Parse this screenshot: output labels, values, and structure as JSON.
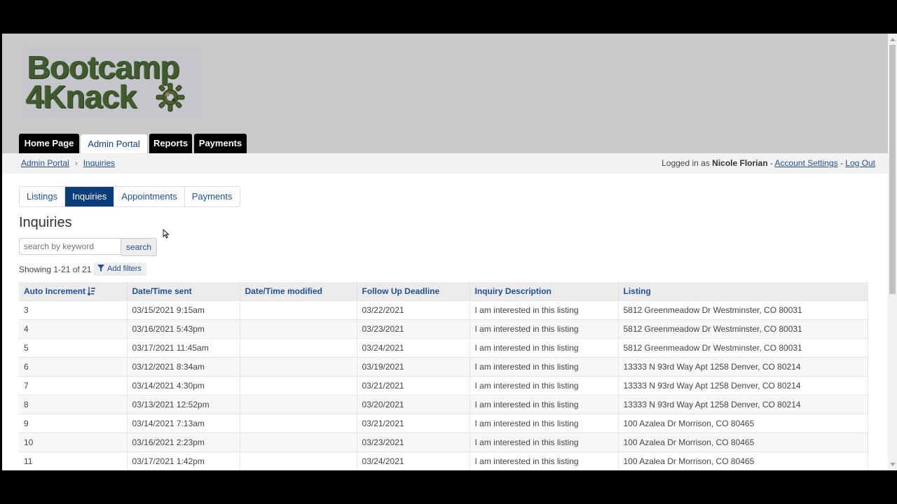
{
  "header": {
    "logo_line1": "Bootcamp",
    "logo_line2": "4Knack",
    "nav": [
      {
        "label": "Home Page"
      },
      {
        "label": "Admin Portal"
      },
      {
        "label": "Reports"
      },
      {
        "label": "Payments"
      }
    ],
    "colors": {
      "header_bg": "#c9c9c9",
      "nav_dark": "#000000",
      "accent": "#0b3d7a",
      "link": "#1f4e9c"
    }
  },
  "breadcrumb": {
    "items": [
      "Admin Portal",
      "Inquiries"
    ]
  },
  "account": {
    "prefix": "Logged in as",
    "user": "Nicole Florian",
    "dash1": "-",
    "settings": "Account Settings",
    "dash2": "-",
    "logout": "Log Out"
  },
  "subtabs": [
    "Listings",
    "Inquiries",
    "Appointments",
    "Payments"
  ],
  "page": {
    "title": "Inquiries"
  },
  "search": {
    "placeholder": "search by keyword",
    "button": "search"
  },
  "records": {
    "showing": "Showing 1-21 of 21",
    "add_filters": "Add filters"
  },
  "table": {
    "columns": [
      "Auto Increment",
      "Date/Time sent",
      "Date/Time modified",
      "Follow Up Deadline",
      "Inquiry Description",
      "Listing"
    ],
    "rows": [
      [
        "3",
        "03/15/2021 9:15am",
        "",
        "03/22/2021",
        "I am interested in this listing",
        "5812 Greenmeadow Dr Westminster, CO 80031"
      ],
      [
        "4",
        "03/16/2021 5:43pm",
        "",
        "03/23/2021",
        "I am interested in this listing",
        "5812 Greenmeadow Dr Westminster, CO 80031"
      ],
      [
        "5",
        "03/17/2021 11:45am",
        "",
        "03/24/2021",
        "I am interested in this listing",
        "5812 Greenmeadow Dr Westminster, CO 80031"
      ],
      [
        "6",
        "03/12/2021 8:34am",
        "",
        "03/19/2021",
        "I am interested in this listing",
        "13333 N 93rd Way Apt 1258 Denver, CO 80214"
      ],
      [
        "7",
        "03/14/2021 4:30pm",
        "",
        "03/21/2021",
        "I am interested in this listing",
        "13333 N 93rd Way Apt 1258 Denver, CO 80214"
      ],
      [
        "8",
        "03/13/2021 12:52pm",
        "",
        "03/20/2021",
        "I am interested in this listing",
        "13333 N 93rd Way Apt 1258 Denver, CO 80214"
      ],
      [
        "9",
        "03/14/2021 7:13am",
        "",
        "03/21/2021",
        "I am interested in this listing",
        "100 Azalea Dr Morrison, CO 80465"
      ],
      [
        "10",
        "03/16/2021 2:23pm",
        "",
        "03/23/2021",
        "I am interested in this listing",
        "100 Azalea Dr Morrison, CO 80465"
      ],
      [
        "11",
        "03/17/2021 1:42pm",
        "",
        "03/24/2021",
        "I am interested in this listing",
        "100 Azalea Dr Morrison, CO 80465"
      ]
    ]
  }
}
